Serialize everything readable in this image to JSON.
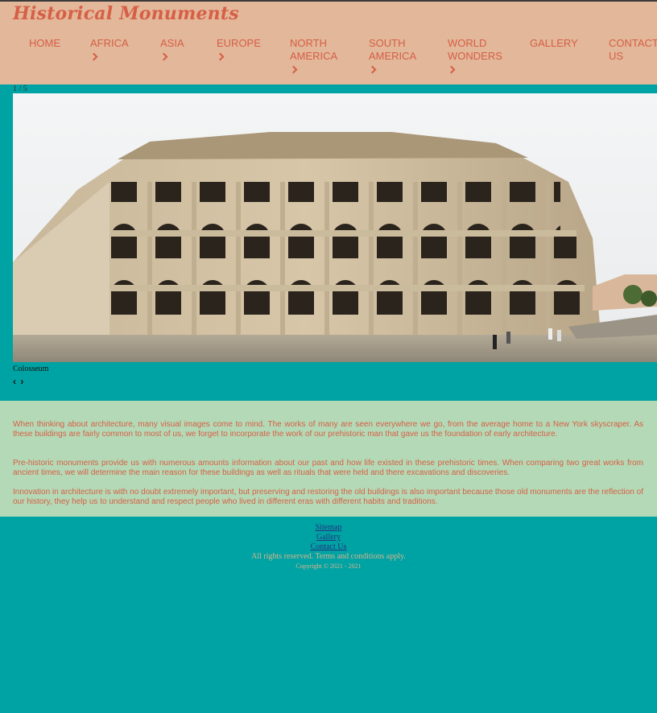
{
  "site": {
    "logo": "Historical Monuments"
  },
  "nav": {
    "items": [
      {
        "label": "HOME"
      },
      {
        "label": "AFRICA"
      },
      {
        "label": "ASIA"
      },
      {
        "label": "EUROPE"
      },
      {
        "label": "NORTH AMERICA"
      },
      {
        "label": "SOUTH AMERICA"
      },
      {
        "label": "WORLD WONDERS"
      },
      {
        "label": "GALLERY"
      },
      {
        "label": "CONTACT US"
      }
    ]
  },
  "slider": {
    "counter": "1 / 5",
    "caption": "Colosseum",
    "prev": "‹",
    "next": "›",
    "image_icon": "colosseum-photo"
  },
  "content": {
    "paragraphs": [
      "When thinking about architecture, many visual images come to mind. The works of many are seen everywhere we go, from the average home to a New York skyscraper. As these buildings are fairly common to most of us, we forget to incorporate the work of our prehistoric man that gave us the foundation of early architecture.",
      "Pre-historic monuments provide us with numerous amounts information about our past and how life existed in these prehistoric times. When comparing two great works from ancient times, we will determine the main reason for these buildings as well as rituals that were held and there excavations and discoveries.",
      "Innovation in architecture is with no doubt extremely important, but preserving and restoring the old buildings is also important because those old monuments are the reflection of our history, they help us to understand and respect people who lived in different eras with different habits and traditions."
    ]
  },
  "footer": {
    "sitemap": "Sitemap",
    "gallery": "Gallery",
    "contact": "Contact Us",
    "rights": "All rights reserved. Terms and conditions apply.",
    "copyright": "Copyright © 2021 - 2021"
  },
  "colors": {
    "accent": "#d65f45",
    "header_bg": "#e2b79a",
    "page_bg": "#00a3a3",
    "content_bg": "#b4d9b6"
  }
}
